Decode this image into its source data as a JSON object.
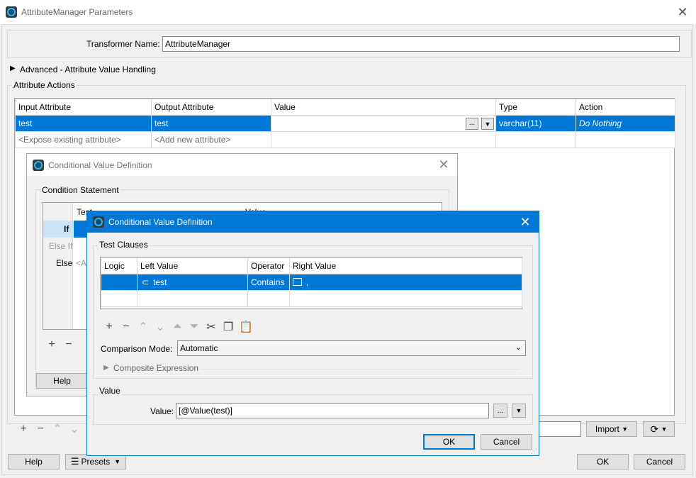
{
  "main": {
    "title": "AttributeManager Parameters",
    "transformer_name_label": "Transformer Name:",
    "transformer_name_value": "AttributeManager",
    "advanced_label": "Advanced - Attribute Value Handling",
    "attribute_actions_label": "Attribute Actions",
    "columns": [
      "Input Attribute",
      "Output Attribute",
      "Value",
      "Type",
      "Action"
    ],
    "rows": [
      {
        "input": "test",
        "output": "test",
        "value": "",
        "type": "varchar(11)",
        "action": "Do Nothing"
      },
      {
        "input": "<Expose existing attribute>",
        "output": "<Add new attribute>",
        "value": "",
        "type": "",
        "action": ""
      }
    ],
    "import_label": "Import",
    "help_label": "Help",
    "presets_label": "Presets",
    "ok_label": "OK",
    "cancel_label": "Cancel"
  },
  "dialog1": {
    "title": "Conditional Value Definition",
    "condition_statement_label": "Condition Statement",
    "col_test": "Test",
    "col_value": "Value",
    "row_if": "If",
    "row_else_if": "Else If",
    "row_else": "Else",
    "else_cell": "<A",
    "help_label": "Help"
  },
  "dialog2": {
    "title": "Conditional Value Definition",
    "test_clauses_label": "Test Clauses",
    "columns": [
      "Logic",
      "Left Value",
      "Operator",
      "Right Value"
    ],
    "row": {
      "logic": "",
      "left": "test",
      "operator": "Contains",
      "right": ","
    },
    "comparison_mode_label": "Comparison Mode:",
    "comparison_mode_value": "Automatic",
    "composite_label": "Composite Expression",
    "value_group_label": "Value",
    "value_label": "Value:",
    "value_text": "[@Value(test)]",
    "ok_label": "OK",
    "cancel_label": "Cancel"
  },
  "colors": {
    "accent": "#0078d7",
    "selected_row": "#0078d7"
  }
}
